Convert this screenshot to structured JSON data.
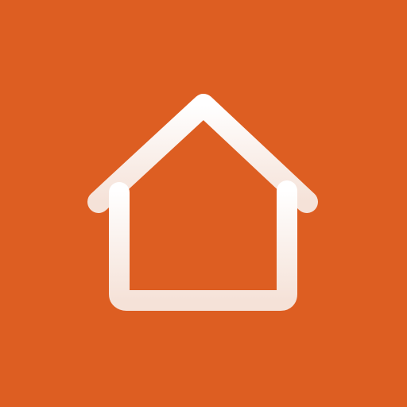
{
  "app_icon": {
    "icon": "home-icon",
    "colors": {
      "background": "#DD5E22",
      "icon_top": "#FFFFFF",
      "icon_bottom": "#F5E2D8"
    }
  }
}
